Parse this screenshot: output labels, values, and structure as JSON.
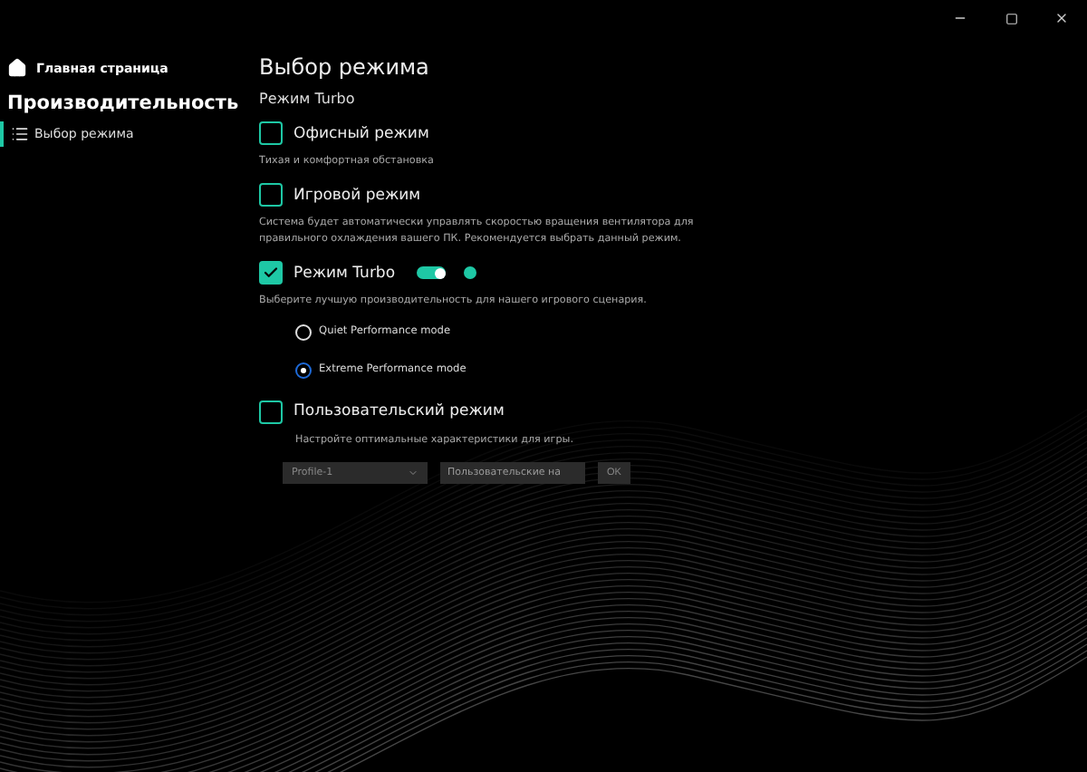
{
  "sidebar": {
    "home": "Главная страница",
    "section": "Производительность",
    "items": [
      {
        "label": "Выбор режима",
        "selected": true
      }
    ]
  },
  "main": {
    "title": "Выбор режима",
    "subtitle": "Режим Turbo",
    "options": [
      {
        "kind": "plain",
        "label": "Офисный режим",
        "checked": false,
        "description": "Тихая и комфортная обстановка"
      },
      {
        "kind": "plain",
        "label": "Игровой режим",
        "checked": false,
        "description": "Система будет автоматически управлять скоростью вращения вентилятора для правильного охлаждения вашего ПК. Рекомендуется выбрать данный режим."
      },
      {
        "kind": "turbo",
        "label": "Режим Turbo",
        "checked": true,
        "toggle_on": true,
        "description": "Выберите лучшую производительность для нашего игрового сценария.",
        "radios": [
          {
            "label": "Quiet Performance mode",
            "selected": false
          },
          {
            "label": "Extreme Performance mode",
            "selected": true
          }
        ]
      },
      {
        "kind": "custom",
        "label": "Пользовательский режим",
        "checked": false,
        "description": "Настройте оптимальные характеристики для игры.",
        "profile": "Profile-1",
        "name_value": "Пользовательские на",
        "ok": "OK"
      }
    ]
  }
}
